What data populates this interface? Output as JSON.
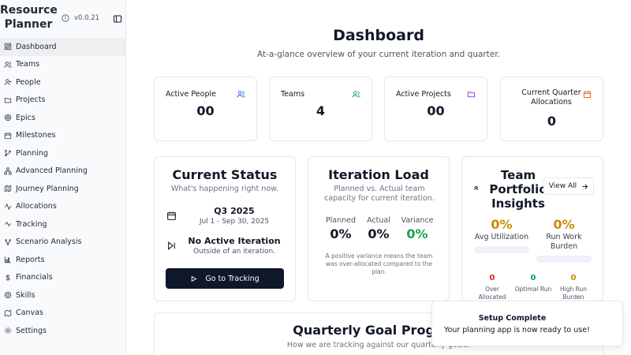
{
  "app": {
    "name": "Resource Planner",
    "version": "v0.0.21"
  },
  "sidebar": {
    "items": [
      {
        "label": "Dashboard",
        "icon": "dashboard-icon",
        "active": true
      },
      {
        "label": "Teams",
        "icon": "users-icon"
      },
      {
        "label": "People",
        "icon": "user-icon"
      },
      {
        "label": "Projects",
        "icon": "folder-icon"
      },
      {
        "label": "Epics",
        "icon": "target-icon"
      },
      {
        "label": "Milestones",
        "icon": "calendar-icon"
      },
      {
        "label": "Planning",
        "icon": "git-branch-icon"
      },
      {
        "label": "Advanced Planning",
        "icon": "network-icon"
      },
      {
        "label": "Journey Planning",
        "icon": "map-icon"
      },
      {
        "label": "Allocations",
        "icon": "activity-icon"
      },
      {
        "label": "Tracking",
        "icon": "trending-icon"
      },
      {
        "label": "Scenario Analysis",
        "icon": "flow-icon"
      },
      {
        "label": "Reports",
        "icon": "bar-chart-icon"
      },
      {
        "label": "Financials",
        "icon": "dollar-icon"
      },
      {
        "label": "Skills",
        "icon": "skills-icon"
      },
      {
        "label": "Canvas",
        "icon": "canvas-icon"
      },
      {
        "label": "Settings",
        "icon": "settings-icon"
      }
    ]
  },
  "header": {
    "title": "Dashboard",
    "subtitle": "At-a-glance overview of your current iteration and quarter."
  },
  "stats": {
    "active_people": {
      "label": "Active People",
      "value": "00"
    },
    "teams": {
      "label": "Teams",
      "value": "4"
    },
    "active_projects": {
      "label": "Active Projects",
      "value": "00"
    },
    "allocations": {
      "label": "Current Quarter Allocations",
      "value": "0"
    }
  },
  "current_status": {
    "title": "Current Status",
    "subtitle": "What's happening right now.",
    "quarter": "Q3 2025",
    "quarter_range": "Jul 1 - Sep 30, 2025",
    "iteration": "No Active Iteration",
    "iteration_sub": "Outside of an iteration.",
    "button": "Go to Tracking"
  },
  "iteration_load": {
    "title": "Iteration Load",
    "subtitle": "Planned vs. Actual team capacity for current iteration.",
    "planned_label": "Planned",
    "planned_value": "0%",
    "actual_label": "Actual",
    "actual_value": "0%",
    "variance_label": "Variance",
    "variance_value": "0%",
    "note": "A positive variance means the team was over-allocated compared to the plan."
  },
  "portfolio": {
    "title": "Team Portfolio Insights",
    "view_all": "View All",
    "avg_util_value": "0%",
    "avg_util_label": "Avg Utilization",
    "avg_util_fraction": 0,
    "run_work_value": "0%",
    "run_work_label": "Run Work Burden",
    "run_work_fraction": 0,
    "over_count": "0",
    "over_label": "Over Allocated",
    "optimal_count": "0",
    "optimal_label": "Optimal Run",
    "high_count": "0",
    "high_label": "High Run Burden",
    "colors": {
      "over": "#dc2626",
      "optimal": "#16a34a",
      "high": "#ca8a04"
    }
  },
  "quarterly": {
    "title": "Quarterly Goal Progress",
    "subtitle": "How we are tracking against our quarterly goals."
  },
  "toast": {
    "title": "Setup Complete",
    "message": "Your planning app is now ready to use!"
  }
}
